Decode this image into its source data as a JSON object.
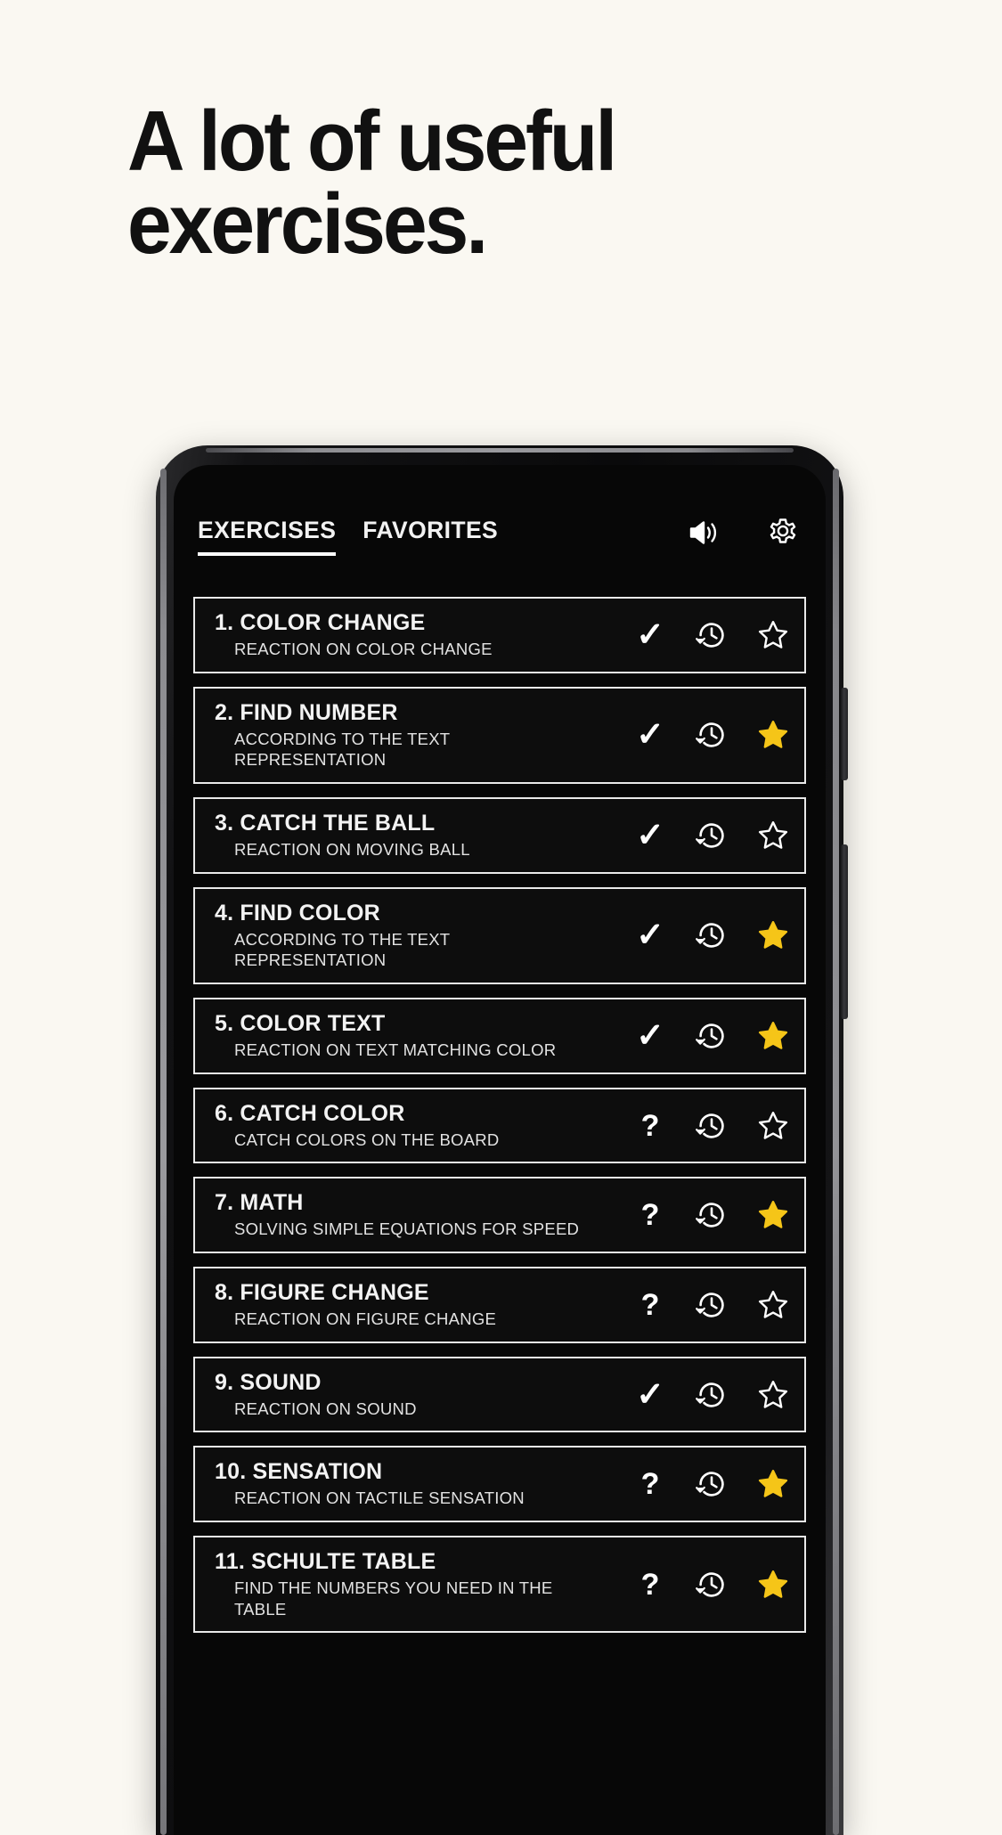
{
  "page": {
    "background_color": "#faf8f2",
    "headline": "A lot of useful\nexercises."
  },
  "app": {
    "screen_bg": "#070707",
    "accent_star_color": "#f5c518",
    "tabs": [
      {
        "label": "EXERCISES",
        "active": true
      },
      {
        "label": "FAVORITES",
        "active": false
      }
    ],
    "top_icons": [
      {
        "name": "sound-icon",
        "label": "Sound"
      },
      {
        "name": "settings-icon",
        "label": "Settings"
      }
    ],
    "exercises": [
      {
        "number": "1.",
        "title": "COLOR CHANGE",
        "subtitle": "REACTION ON COLOR CHANGE",
        "status": "✓",
        "status_type": "check",
        "history": "history-icon",
        "favorite": false
      },
      {
        "number": "2.",
        "title": "FIND NUMBER",
        "subtitle": "ACCORDING TO THE TEXT\nREPRESENTATION",
        "status": "✓",
        "status_type": "check",
        "history": "history-icon",
        "favorite": true
      },
      {
        "number": "3.",
        "title": "CATCH THE BALL",
        "subtitle": "REACTION ON MOVING BALL",
        "status": "✓",
        "status_type": "check",
        "history": "history-icon",
        "favorite": false
      },
      {
        "number": "4.",
        "title": "FIND COLOR",
        "subtitle": "ACCORDING TO THE TEXT\nREPRESENTATION",
        "status": "✓",
        "status_type": "check",
        "history": "history-icon",
        "favorite": true
      },
      {
        "number": "5.",
        "title": "COLOR TEXT",
        "subtitle": "REACTION ON TEXT MATCHING COLOR",
        "status": "✓",
        "status_type": "check",
        "history": "history-icon",
        "favorite": true
      },
      {
        "number": "6.",
        "title": "CATCH COLOR",
        "subtitle": "CATCH COLORS ON THE BOARD",
        "status": "?",
        "status_type": "question",
        "history": "history-icon",
        "favorite": false
      },
      {
        "number": "7.",
        "title": "MATH",
        "subtitle": "SOLVING SIMPLE EQUATIONS FOR SPEED",
        "status": "?",
        "status_type": "question",
        "history": "history-icon",
        "favorite": true
      },
      {
        "number": "8.",
        "title": "FIGURE CHANGE",
        "subtitle": "REACTION ON FIGURE CHANGE",
        "status": "?",
        "status_type": "question",
        "history": "history-icon",
        "favorite": false
      },
      {
        "number": "9.",
        "title": "SOUND",
        "subtitle": "REACTION ON SOUND",
        "status": "✓",
        "status_type": "check",
        "history": "history-icon",
        "favorite": false
      },
      {
        "number": "10.",
        "title": "SENSATION",
        "subtitle": "REACTION ON TACTILE SENSATION",
        "status": "?",
        "status_type": "question",
        "history": "history-icon",
        "favorite": true
      },
      {
        "number": "11.",
        "title": "SCHULTE TABLE",
        "subtitle": "FIND THE NUMBERS YOU NEED IN THE\nTABLE",
        "status": "?",
        "status_type": "question",
        "history": "history-icon",
        "favorite": true
      }
    ]
  }
}
